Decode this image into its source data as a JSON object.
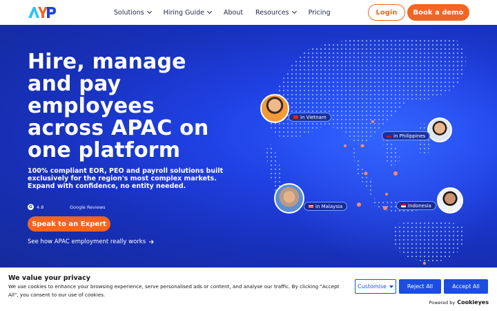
{
  "nav": {
    "logo_alt": "AYP",
    "items": [
      {
        "label": "Solutions",
        "has_dropdown": true
      },
      {
        "label": "Hiring Guide",
        "has_dropdown": true
      },
      {
        "label": "About",
        "has_dropdown": false
      },
      {
        "label": "Resources",
        "has_dropdown": true
      },
      {
        "label": "Pricing",
        "has_dropdown": false
      }
    ],
    "login_label": "Login",
    "demo_label": "Book a demo"
  },
  "hero": {
    "headline": "Hire, manage and pay employees across APAC on one platform",
    "subheadline": "100% compliant EOR, PEO and payroll solutions built exclusively for the region's most complex markets. Expand with confidence, no entity needed.",
    "rating_value": "4.8",
    "rating_source": "Google Reviews",
    "cta_label": "Speak to an Expert",
    "secondary_link": "See how APAC employment really works",
    "locations": [
      {
        "label": "in Vietnam"
      },
      {
        "label": "in Philippines"
      },
      {
        "label": "in Malaysia"
      },
      {
        "label": "Indonesia"
      }
    ]
  },
  "cookie": {
    "title": "We value your privacy",
    "text": "We use cookies to enhance your browsing experience, serve personalised ads or content, and analyse our traffic. By clicking \"Accept All\", you consent to our use of cookies.",
    "customise_label": "Customise",
    "reject_label": "Reject All",
    "accept_label": "Accept All",
    "powered_prefix": "Powered by",
    "powered_brand": "Cookieyes"
  },
  "colors": {
    "accent": "#f26522",
    "hero_blue": "#1f3fe0",
    "cookie_blue": "#1b4de0"
  }
}
